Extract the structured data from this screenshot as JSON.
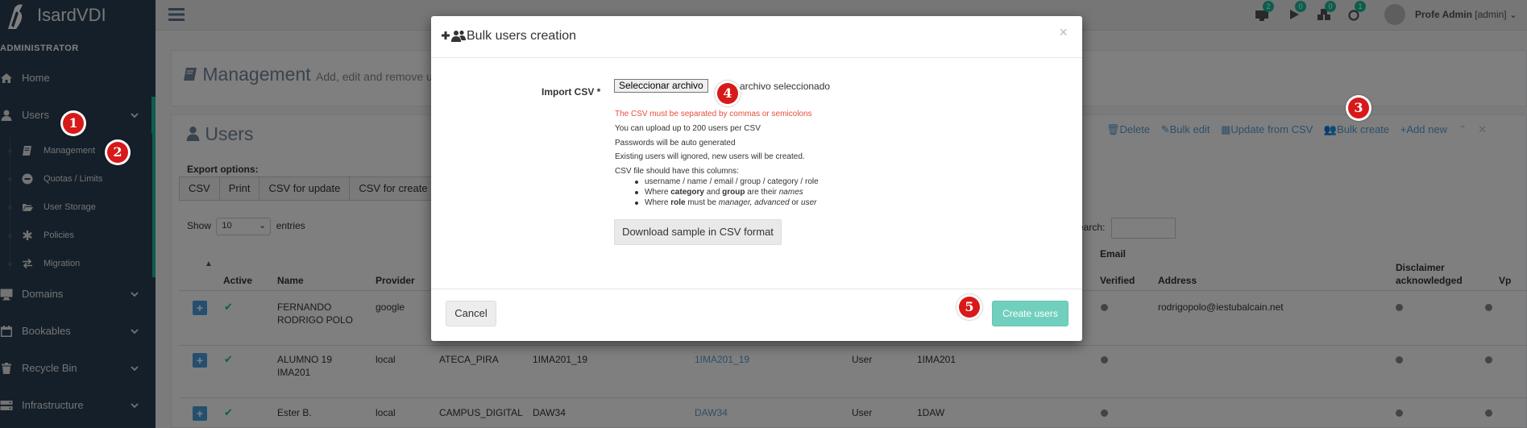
{
  "app": {
    "brand": "IsardVDI",
    "role_label": "ADMINISTRATOR",
    "user_name": "Profe Admin",
    "user_role": "[admin]"
  },
  "sidebar": {
    "items": [
      {
        "label": "Home",
        "icon": "home-icon"
      },
      {
        "label": "Users",
        "icon": "user-icon"
      },
      {
        "label": "Domains",
        "icon": "desktop-icon"
      },
      {
        "label": "Bookables",
        "icon": "calendar-icon"
      },
      {
        "label": "Recycle Bin",
        "icon": "trash-icon"
      },
      {
        "label": "Infrastructure",
        "icon": "server-icon"
      }
    ],
    "subitems": [
      {
        "label": "Management",
        "icon": "book-icon"
      },
      {
        "label": "Quotas / Limits",
        "icon": "minus-circle-icon"
      },
      {
        "label": "User Storage",
        "icon": "folder-open-icon"
      },
      {
        "label": "Policies",
        "icon": "asterisk-icon"
      },
      {
        "label": "Migration",
        "icon": "exchange-icon"
      }
    ]
  },
  "topbar": {
    "badges": [
      "2",
      "0",
      "0",
      "1"
    ],
    "badge_color": "#1abb9c"
  },
  "management": {
    "title": "Management",
    "subtitle": "Add, edit and remove us"
  },
  "users_panel": {
    "title": "Users",
    "actions": [
      "Delete",
      "Bulk edit",
      "Update from CSV",
      "Bulk create",
      "Add new"
    ],
    "export_label": "Export options:",
    "export_buttons": [
      "CSV",
      "Print",
      "CSV for update",
      "CSV for create"
    ],
    "show": "Show",
    "entries_value": "10",
    "entries_label": "entries",
    "search_label": "earch:",
    "group_header_email": "Email",
    "columns": [
      "Active",
      "Name",
      "Provider",
      "Verified",
      "Address",
      "Disclaimer acknowledged",
      "Vp"
    ],
    "rows": [
      {
        "name": "FERNANDO RODRIGO POLO",
        "provider": "google",
        "category": "",
        "group": "",
        "username": "",
        "role": "",
        "groupcode": "",
        "email": "rodrigopolo@iestubalcain.net"
      },
      {
        "name": "ALUMNO 19 IMA201",
        "provider": "local",
        "category": "ATECA_PIRA",
        "group": "1IMA201_19",
        "username": "1IMA201_19",
        "role": "User",
        "groupcode": "1IMA201",
        "email": ""
      },
      {
        "name": "Ester B.",
        "provider": "local",
        "category": "CAMPUS_DIGITAL",
        "group": "DAW34",
        "username": "DAW34",
        "role": "User",
        "groupcode": "1DAW",
        "email": ""
      }
    ]
  },
  "modal": {
    "title": "Bulk users creation",
    "import_label": "Import CSV *",
    "file_button": "Seleccionar archivo",
    "file_status": "archivo seleccionado",
    "info": {
      "warning": "The CSV must be separated by commas or semicolons",
      "line1": "You can upload up to 200 users per CSV",
      "line2": "Passwords will be auto generated",
      "line3": "Existing users will ignored, new users will be created.",
      "line4": "CSV file should have this columns:",
      "bullet1": "username / name / email / group / category / role",
      "bullet2_a": "Where ",
      "bullet2_b": "category",
      "bullet2_c": " and ",
      "bullet2_d": "group",
      "bullet2_e": " are their ",
      "bullet2_f": "names",
      "bullet3_a": "Where ",
      "bullet3_b": "role",
      "bullet3_c": " must be ",
      "bullet3_d": "manager, advanced",
      "bullet3_e": " or ",
      "bullet3_f": "user"
    },
    "download_button": "Download sample in CSV format",
    "cancel_button": "Cancel",
    "create_button": "Create users",
    "close": "×"
  },
  "markers": [
    "1",
    "2",
    "3",
    "4",
    "5"
  ],
  "colors": {
    "sidebar": "#2a3f54",
    "accent": "#1abb9c",
    "marker": "#d81919",
    "link": "#5a9fd4"
  }
}
